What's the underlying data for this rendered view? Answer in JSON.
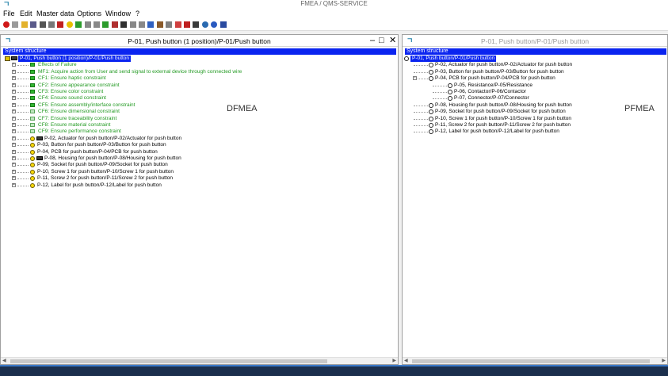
{
  "app": {
    "title": "FMEA / QMS-SERVICE",
    "logo": "ㄱ"
  },
  "menu": [
    "File",
    "Edit",
    "Master data",
    "Options",
    "Window",
    "?"
  ],
  "toolbar_icons": [
    {
      "name": "stop-icon",
      "color": "#d01818"
    },
    {
      "name": "new-icon",
      "color": "#9a9a9a"
    },
    {
      "name": "open-icon",
      "color": "#e3b22c"
    },
    {
      "name": "save-icon",
      "color": "#5a5a8a"
    },
    {
      "name": "print-icon",
      "color": "#555555"
    },
    {
      "name": "cut-icon",
      "color": "#777777"
    },
    {
      "name": "delete-icon",
      "color": "#c02020"
    },
    {
      "name": "warning-icon",
      "color": "#e8c000"
    },
    {
      "name": "grid-icon",
      "color": "#2c9c2c"
    },
    {
      "name": "list-icon",
      "color": "#888888"
    },
    {
      "name": "table-icon",
      "color": "#888888"
    },
    {
      "name": "tree-icon",
      "color": "#2c9c2c"
    },
    {
      "name": "form-icon",
      "color": "#b03030"
    },
    {
      "name": "layers-icon",
      "color": "#303030"
    },
    {
      "name": "doc-icon",
      "color": "#888888"
    },
    {
      "name": "filter-icon",
      "color": "#888888"
    },
    {
      "name": "chart-icon",
      "color": "#3060c0"
    },
    {
      "name": "book-icon",
      "color": "#8a5a2a"
    },
    {
      "name": "image-icon",
      "color": "#808080"
    },
    {
      "name": "alert-icon",
      "color": "#d04040"
    },
    {
      "name": "flag-icon",
      "color": "#c02020"
    },
    {
      "name": "tools-icon",
      "color": "#3a3a3a"
    },
    {
      "name": "globe-icon",
      "color": "#2a6ab0"
    },
    {
      "name": "clock-icon",
      "color": "#2a5ac0"
    },
    {
      "name": "exit-icon",
      "color": "#2a4aa0"
    }
  ],
  "left_pane": {
    "title": "P-01, Push button (1 position)/P-01/Push button",
    "section": "System structure",
    "label": "DFMEA",
    "root": "P-01, Push button (1 position)/P-01/Push button",
    "rows": [
      {
        "text": "Effects of Failure",
        "icon": "green",
        "color": "green"
      },
      {
        "text": "MF1: Acquire action from User and send signal to external device through connected wire",
        "icon": "green",
        "color": "green"
      },
      {
        "text": "CF1: Ensure haptic constraint",
        "icon": "green",
        "color": "green"
      },
      {
        "text": "CF2: Ensure appearance constraint",
        "icon": "green",
        "color": "green"
      },
      {
        "text": "CF3: Ensure color constraint",
        "icon": "green",
        "color": "green"
      },
      {
        "text": "CF4: Ensure sound constraint",
        "icon": "green",
        "color": "green"
      },
      {
        "text": "CF5: Ensure assembly/interface constraint",
        "icon": "green",
        "color": "green"
      },
      {
        "text": "CF6: Ensure dimensional constraint",
        "icon": "lightgreen",
        "color": "green"
      },
      {
        "text": "CF7: Ensure traceability constraint",
        "icon": "lightgreen",
        "color": "green"
      },
      {
        "text": "CF8: Ensure material constraint",
        "icon": "lightgreen",
        "color": "green"
      },
      {
        "text": "CF9: Ensure performance constraint",
        "icon": "lightgreen",
        "color": "green"
      },
      {
        "text": "P-02, Actuator for push button/P-02/Actuator for push button",
        "icon": "yellow-dark",
        "color": "black"
      },
      {
        "text": "P-03, Button for push button/P-03/Button for push button",
        "icon": "yellow",
        "color": "black"
      },
      {
        "text": "P-04, PCB for push button/P-04/PCB for push button",
        "icon": "yellow",
        "color": "black"
      },
      {
        "text": "P-08, Housing for push button/P-08/Housing for push button",
        "icon": "yellow-dark",
        "color": "black"
      },
      {
        "text": "P-09, Socket for push button/P-09/Socket for push button",
        "icon": "yellow",
        "color": "black"
      },
      {
        "text": "P-10, Screw 1 for push button/P-10/Screw 1 for push button",
        "icon": "yellow",
        "color": "black"
      },
      {
        "text": "P-11, Screw 2 for push button/P-11/Screw 2 for push button",
        "icon": "yellow",
        "color": "black"
      },
      {
        "text": "P-12, Label for push button/P-12/Label for push button",
        "icon": "yellow",
        "color": "black"
      }
    ]
  },
  "right_pane": {
    "title": "P-01, Push button/P-01/Push button",
    "section": "System structure",
    "label": "PFMEA",
    "root": "P-01, Push button/P-01/Push button",
    "rows": [
      {
        "text": "P-02, Actuator for push button/P-02/Actuator for push button",
        "level": 1
      },
      {
        "text": "P-03, Button for push button/P-03/Button for push button",
        "level": 1
      },
      {
        "text": "P-04, PCB for push button/P-04/PCB for push button",
        "level": 1
      },
      {
        "text": "P-05, Resistance/P-05/Resistance",
        "level": 2
      },
      {
        "text": "P-06, Contactor/P-06/Contactor",
        "level": 2
      },
      {
        "text": "P-07, Connector/P-07/Connector",
        "level": 2
      },
      {
        "text": "P-08, Housing for push button/P-08/Housing for push button",
        "level": 1
      },
      {
        "text": "P-09, Socket for push button/P-09/Socket for push button",
        "level": 1
      },
      {
        "text": "P-10, Screw 1 for push button/P-10/Screw 1 for push button",
        "level": 1
      },
      {
        "text": "P-11, Screw 2 for push button/P-11/Screw 2 for push button",
        "level": 1
      },
      {
        "text": "P-12, Label for push button/P-12/Label for push button",
        "level": 1
      }
    ]
  },
  "window_controls": {
    "minimize": "–",
    "maximize": "□",
    "close": "✕"
  }
}
